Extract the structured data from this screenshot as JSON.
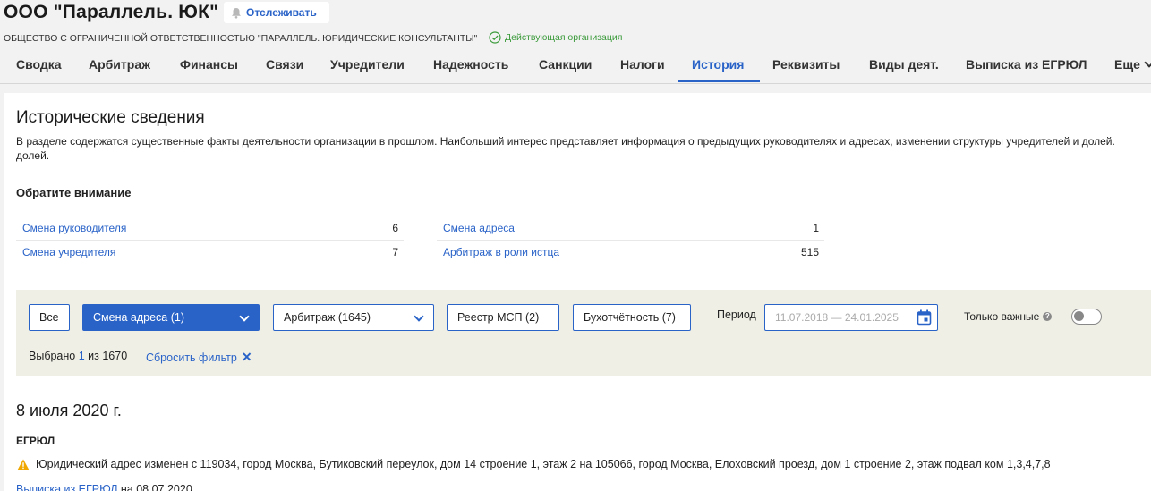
{
  "header": {
    "company_title": "ООО \"Параллель. ЮК\"",
    "track_label": "Отслеживать",
    "full_name": "ОБЩЕСТВО С ОГРАНИЧЕННОЙ ОТВЕТСТВЕННОСТЬЮ \"ПАРАЛЛЕЛЬ. ЮРИДИЧЕСКИЕ КОНСУЛЬТАНТЫ\"",
    "status": "Действующая организация",
    "status_color": "#3a9a3a"
  },
  "tabs": [
    {
      "label": "Сводка",
      "active": false
    },
    {
      "label": "Арбитраж",
      "active": false
    },
    {
      "label": "Финансы",
      "active": false
    },
    {
      "label": "Связи",
      "active": false
    },
    {
      "label": "Учредители",
      "active": false
    },
    {
      "label": "Надежность",
      "active": false
    },
    {
      "label": "Санкции",
      "active": false
    },
    {
      "label": "Налоги",
      "active": false
    },
    {
      "label": "История",
      "active": true
    },
    {
      "label": "Реквизиты",
      "active": false
    },
    {
      "label": "Виды деят.",
      "active": false
    },
    {
      "label": "Выписка из ЕГРЮЛ",
      "active": false
    },
    {
      "label": "Еще",
      "active": false
    }
  ],
  "main": {
    "title": "Исторические сведения",
    "description_line1": "В разделе содержатся существенные факты деятельности организации в прошлом. Наибольший интерес представляет информация о предыдущих руководителях и адресах, изменении структуры учредителей и долей.",
    "description_line2": "долей.",
    "notice_title": "Обратите внимание",
    "stats": [
      {
        "label": "Смена руководителя",
        "value": "6"
      },
      {
        "label": "Смена учредителя",
        "value": "7"
      },
      {
        "label": "Смена адреса",
        "value": "1"
      },
      {
        "label": "Арбитраж в роли истца",
        "value": "515"
      }
    ]
  },
  "filters": {
    "all_label": "Все",
    "buttons": [
      {
        "label": "Смена адреса (1)",
        "active": true,
        "dropdown": true
      },
      {
        "label": "Арбитраж (1645)",
        "active": false,
        "dropdown": true
      },
      {
        "label": "Реестр МСП (2)",
        "active": false,
        "dropdown": false
      },
      {
        "label": "Бухотчётность (7)",
        "active": false,
        "dropdown": false
      }
    ],
    "period_label": "Период",
    "period_placeholder": "11.07.2018 — 24.01.2025",
    "only_important_label": "Только важные",
    "only_important_on": false,
    "selected_prefix": "Выбрано",
    "selected_count": "1",
    "selected_suffix": "из 1670",
    "reset_label": "Сбросить фильтр"
  },
  "event": {
    "date": "8 июля 2020 г.",
    "source": "ЕГРЮЛ",
    "text": "Юридический адрес изменен с 119034, город Москва, Бутиковский переулок, дом 14 строение 1, этаж 2 на 105066, город Москва, Елоховский проезд, дом 1 строение 2, этаж подвал ком 1,3,4,7,8",
    "extract_link": "Выписка из ЕГРЮЛ",
    "extract_date": "на 08.07.2020"
  },
  "colors": {
    "accent": "#2a63c8",
    "warning": "#f0a800"
  }
}
